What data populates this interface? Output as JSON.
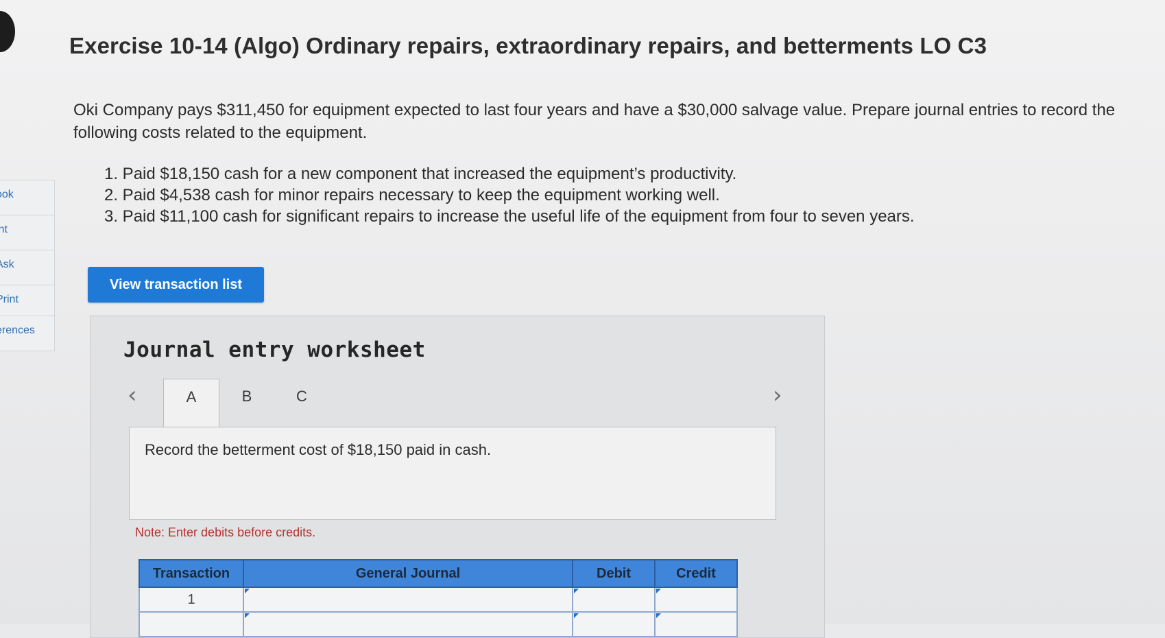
{
  "sidebar": {
    "items": [
      {
        "label": "ook"
      },
      {
        "label": "int"
      },
      {
        "label": "Ask"
      },
      {
        "label": "Print"
      },
      {
        "label": "erences"
      }
    ]
  },
  "exercise": {
    "title": "Exercise 10-14 (Algo) Ordinary repairs, extraordinary repairs, and betterments LO C3",
    "intro": "Oki Company pays $311,450 for equipment expected to last four years and have a $30,000 salvage value. Prepare journal entries to record the following costs related to the equipment.",
    "tasks": [
      "1. Paid $18,150 cash for a new component that increased the equipment’s productivity.",
      "2. Paid $4,538 cash for minor repairs necessary to keep the equipment working well.",
      "3. Paid $11,100 cash for significant repairs to increase the useful life of the equipment from four to seven years."
    ],
    "view_button": "View transaction list"
  },
  "worksheet": {
    "title": "Journal entry worksheet",
    "prev": "‹",
    "next": "›",
    "tabs": [
      {
        "label": "A"
      },
      {
        "label": "B"
      },
      {
        "label": "C"
      }
    ],
    "instruction": "Record the betterment cost of $18,150 paid in cash.",
    "note": "Note: Enter debits before credits.",
    "table": {
      "headers": [
        "Transaction",
        "General Journal",
        "Debit",
        "Credit"
      ],
      "rows": [
        {
          "transaction": "1",
          "general_journal": "",
          "debit": "",
          "credit": ""
        },
        {
          "transaction": "",
          "general_journal": "",
          "debit": "",
          "credit": ""
        }
      ]
    }
  },
  "colors": {
    "accent": "#1e7ad6",
    "table_header": "#3f86db",
    "note": "#b0352d",
    "sidebar_link": "#2f6fb1"
  }
}
